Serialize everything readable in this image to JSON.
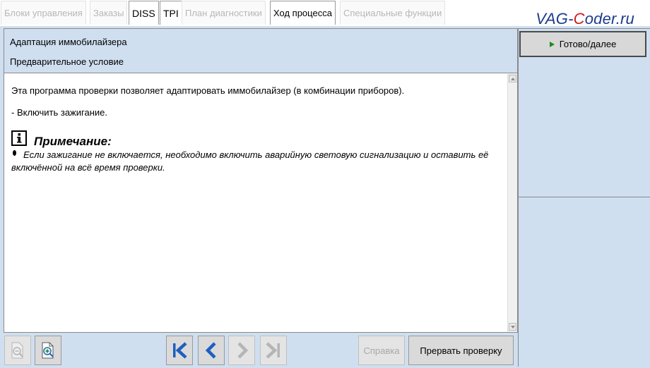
{
  "tabs": [
    {
      "label": "Блоки управления"
    },
    {
      "label": "Заказы"
    },
    {
      "label": "DISS"
    },
    {
      "label": "TPI"
    },
    {
      "label": "План диагностики"
    },
    {
      "label": "Ход процесса"
    },
    {
      "label": "Специальные функции"
    }
  ],
  "brand": {
    "part1": "VAG-",
    "part2": "C",
    "part3": "oder.ru"
  },
  "header": {
    "title": "Адаптация иммобилайзера",
    "subtitle": "Предварительное условие"
  },
  "content": {
    "paragraph1": "Эта программа проверки позволяет адаптировать иммобилайзер (в комбинации приборов).",
    "paragraph2": "- Включить зажигание.",
    "note_title": "Примечание:",
    "note_text": "Если зажигание не включается, необходимо включить аварийную световую сигнализацию и оставить её включённой на всё время проверки."
  },
  "right_panel": {
    "ready_button": "Готово/далее"
  },
  "toolbar": {
    "help_label": "Справка",
    "abort_label": "Прервать проверку"
  },
  "colors": {
    "background": "#cfdff0",
    "nav_blue": "#1f5fbf",
    "play_green": "#1d8a1d"
  }
}
